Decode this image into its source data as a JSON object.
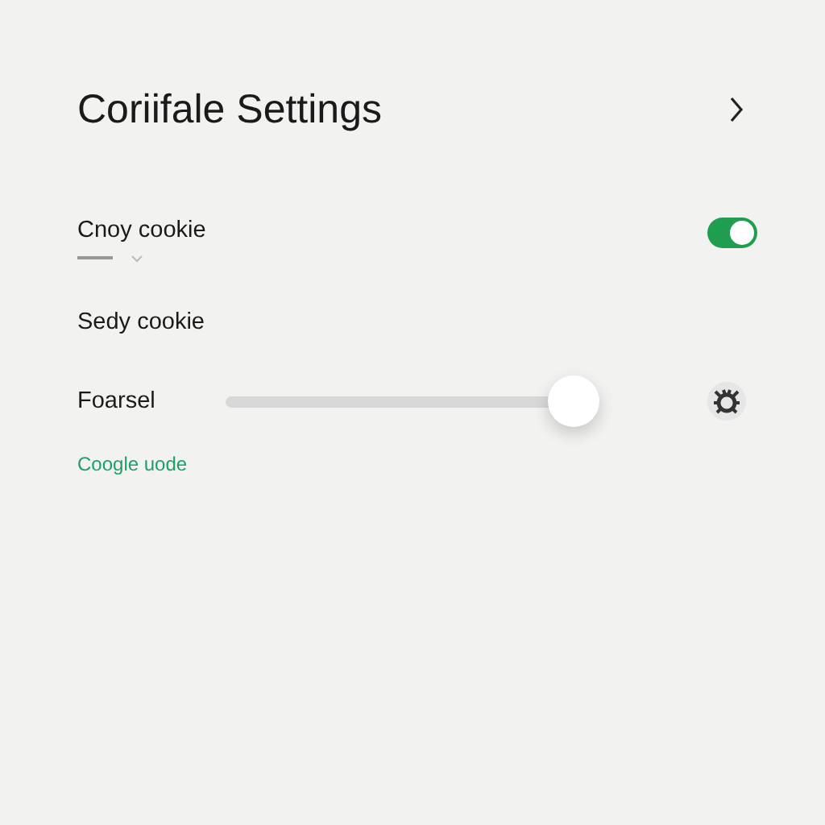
{
  "header": {
    "title": "Coriifale Settings"
  },
  "rows": [
    {
      "kind": "toggle",
      "label": "Cnoy cookie",
      "on": true
    },
    {
      "kind": "plain",
      "label": "Sedy cookie"
    },
    {
      "kind": "slider",
      "label": "Foarsel",
      "level": 0.93
    }
  ],
  "link": "Coogle uode"
}
